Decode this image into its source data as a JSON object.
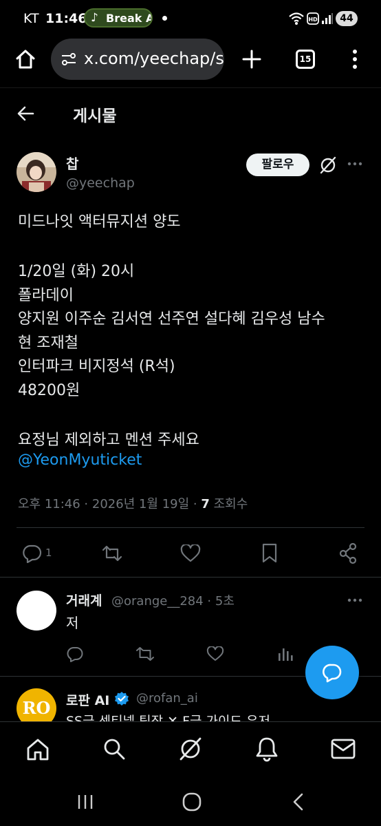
{
  "status_bar": {
    "carrier": "KT",
    "time": "11:46",
    "music_label": "Break A",
    "battery": "44"
  },
  "browser": {
    "url": "x.com/yeechap/st",
    "tab_count": "15"
  },
  "header": {
    "title": "게시물"
  },
  "post": {
    "display_name": "찹",
    "handle": "@yeechap",
    "follow_label": "팔로우",
    "lines": [
      "미드나잇 액터뮤지션 양도",
      "1/20일 (화) 20시",
      "폴라데이",
      "양지원 이주순 김서연 선주연 설다혜 김우성 남수",
      "현 조재철",
      "인터파크 비지정석 (R석)",
      "48200원",
      "요정님 제외하고 멘션 주세요"
    ],
    "mention": "@YeonMyuticket",
    "timestamp": "오후 11:46 · 2026년 1월 19일 · ",
    "views_count": "7",
    "views_label": " 조회수",
    "reply_count": "1"
  },
  "replies": [
    {
      "name": "거래계",
      "handle": "@orange__284 · 5초",
      "text": "저"
    },
    {
      "name": "로판 AI",
      "handle": "@rofan_ai",
      "text": "SS급 센티넬 팀장 ✕ F급 가이드 유저",
      "avatar_text": "RO"
    }
  ],
  "colors": {
    "background": "#000000",
    "accent": "#1d9bf0",
    "text_primary": "#e7e9ea",
    "text_secondary": "#71767b",
    "divider": "#2f3336"
  },
  "icons": [
    "home-icon",
    "search-icon",
    "grok-icon",
    "bell-icon",
    "mail-icon",
    "back-arrow-icon",
    "more-icon",
    "reply-icon",
    "retweet-icon",
    "like-icon",
    "bookmark-icon",
    "share-icon",
    "views-icon",
    "compose-icon",
    "verified-badge-icon"
  ]
}
